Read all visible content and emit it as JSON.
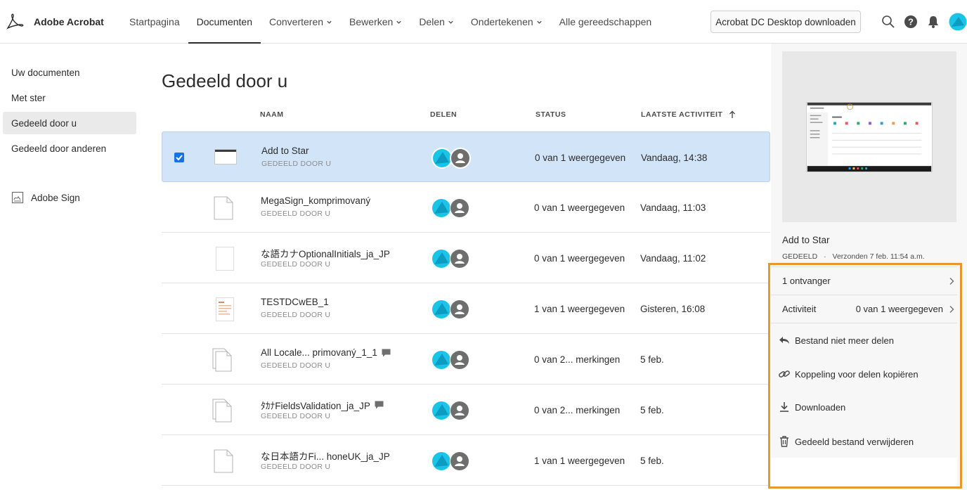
{
  "app": {
    "name": "Adobe Acrobat"
  },
  "nav": {
    "items": [
      {
        "label": "Startpagina",
        "has_menu": false,
        "active": false
      },
      {
        "label": "Documenten",
        "has_menu": false,
        "active": true
      },
      {
        "label": "Converteren",
        "has_menu": true,
        "active": false
      },
      {
        "label": "Bewerken",
        "has_menu": true,
        "active": false
      },
      {
        "label": "Delen",
        "has_menu": true,
        "active": false
      },
      {
        "label": "Ondertekenen",
        "has_menu": true,
        "active": false
      },
      {
        "label": "Alle gereedschappen",
        "has_menu": false,
        "active": false
      }
    ],
    "download_button": "Acrobat DC Desktop downloaden"
  },
  "sidebar": {
    "items": [
      {
        "label": "Uw documenten",
        "active": false
      },
      {
        "label": "Met ster",
        "active": false
      },
      {
        "label": "Gedeeld door u",
        "active": true
      },
      {
        "label": "Gedeeld door anderen",
        "active": false
      }
    ],
    "sign_label": "Adobe Sign"
  },
  "main": {
    "title": "Gedeeld door u",
    "columns": {
      "name": "NAAM",
      "share": "DELEN",
      "status": "STATUS",
      "activity": "LAATSTE ACTIVITEIT"
    },
    "rows": [
      {
        "name": "Add to Star",
        "sub": "GEDEELD DOOR U",
        "status": "0 van 1 weergegeven",
        "activity": "Vandaag, 14:38",
        "selected": true,
        "has_comment": false
      },
      {
        "name": "MegaSign_komprimovaný",
        "sub": "GEDEELD DOOR U",
        "status": "0 van 1 weergegeven",
        "activity": "Vandaag, 11:03",
        "selected": false,
        "has_comment": false
      },
      {
        "name": "な語カナOptionalInitials_ja_JP",
        "sub": "GEDEELD DOOR U",
        "status": "0 van 1 weergegeven",
        "activity": "Vandaag, 11:02",
        "selected": false,
        "has_comment": false
      },
      {
        "name": "TESTDCwEB_1",
        "sub": "GEDEELD DOOR U",
        "status": "1 van 1 weergegeven",
        "activity": "Gisteren, 16:08",
        "selected": false,
        "has_comment": false
      },
      {
        "name": "All Locale... primovaný_1_1",
        "sub": "GEDEELD DOOR U",
        "status": "0 van 2... merkingen",
        "activity": "5 feb.",
        "selected": false,
        "has_comment": true
      },
      {
        "name": "ﾀｶﾅFieldsValidation_ja_JP",
        "sub": "GEDEELD DOOR U",
        "status": "0 van 2... merkingen",
        "activity": "5 feb.",
        "selected": false,
        "has_comment": true
      },
      {
        "name": "な日本語カFi... honeUK_ja_JP",
        "sub": "GEDEELD DOOR U",
        "status": "1 van 1 weergegeven",
        "activity": "5 feb.",
        "selected": false,
        "has_comment": false
      }
    ]
  },
  "panel": {
    "file_name": "Add to Star",
    "status_label": "GEDEELD",
    "sent": "Verzonden 7 feb. 11:54 a.m.",
    "recipients": "1 ontvanger",
    "activity_label": "Activiteit",
    "activity_value": "0 van 1 weergegeven",
    "actions": [
      "Bestand niet meer delen",
      "Koppeling voor delen kopiëren",
      "Downloaden",
      "Gedeeld bestand verwijderen"
    ]
  },
  "colors": {
    "accent_blue": "#1473e6",
    "avatar_cyan": "#1ac4e6",
    "selected_row": "#d2e4f8",
    "highlight": "#e8962d"
  }
}
